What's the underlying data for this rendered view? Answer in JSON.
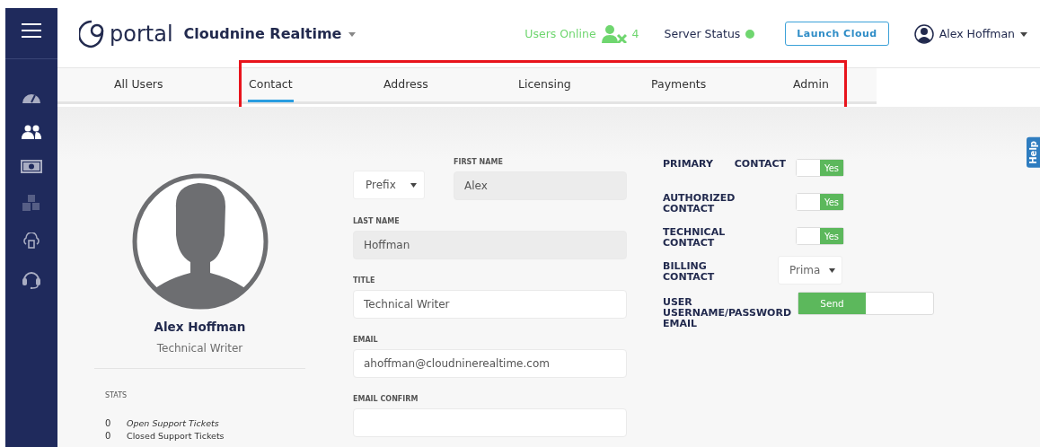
{
  "header": {
    "brand": "portal",
    "company": "Cloudnine Realtime",
    "users_online_label": "Users Online",
    "users_online_count": "4",
    "server_status_label": "Server Status",
    "server_online": true,
    "launch_button": "Launch Cloud",
    "user_name": "Alex Hoffman"
  },
  "sidebar": {
    "items": [
      {
        "kind": "gauge",
        "selected": false,
        "disabled": false
      },
      {
        "kind": "users",
        "selected": true,
        "disabled": false
      },
      {
        "kind": "money",
        "selected": false,
        "disabled": false
      },
      {
        "kind": "cubes",
        "selected": false,
        "disabled": true
      },
      {
        "kind": "cloud",
        "selected": false,
        "disabled": false
      },
      {
        "kind": "headset",
        "selected": false,
        "disabled": false
      }
    ]
  },
  "tabs": [
    {
      "label": "All Users",
      "selected": false
    },
    {
      "label": "Contact",
      "selected": true
    },
    {
      "label": "Address",
      "selected": false
    },
    {
      "label": "Licensing",
      "selected": false
    },
    {
      "label": "Payments",
      "selected": false
    },
    {
      "label": "Admin",
      "selected": false
    }
  ],
  "help_tab": "Help",
  "profile": {
    "name": "Alex Hoffman",
    "title": "Technical Writer",
    "stats_heading": "STATS",
    "stats": [
      {
        "count": "0",
        "label": "Open Support Tickets",
        "emphasized": true
      },
      {
        "count": "0",
        "label": "Closed Support Tickets",
        "emphasized": false
      }
    ]
  },
  "form": {
    "prefix": "Prefix",
    "first_name": {
      "label": "FIRST NAME",
      "value": "Alex",
      "readonly": true
    },
    "fields": [
      {
        "label": "LAST NAME",
        "value": "Hoffman",
        "readonly": true
      },
      {
        "label": "TITLE",
        "value": "Technical Writer",
        "readonly": false
      },
      {
        "label": "EMAIL",
        "value": "ahoffman@cloudninerealtime.com",
        "readonly": false
      },
      {
        "label": "EMAIL CONFIRM",
        "readonly": false
      }
    ]
  },
  "contact_options": [
    {
      "label": "PRIMARY CONTACT",
      "kind": "toggle",
      "on": true,
      "on_label": "Yes"
    },
    {
      "label": "AUTHORIZED CONTACT",
      "kind": "toggle",
      "on": true,
      "on_label": "Yes"
    },
    {
      "label": "TECHNICAL CONTACT",
      "kind": "toggle",
      "on": true,
      "on_label": "Yes"
    },
    {
      "label": "BILLING CONTACT",
      "kind": "select",
      "value": "Prima"
    },
    {
      "label": "USER USERNAME/PASSWORD EMAIL",
      "kind": "send",
      "on": true,
      "on_label": "Send"
    }
  ]
}
